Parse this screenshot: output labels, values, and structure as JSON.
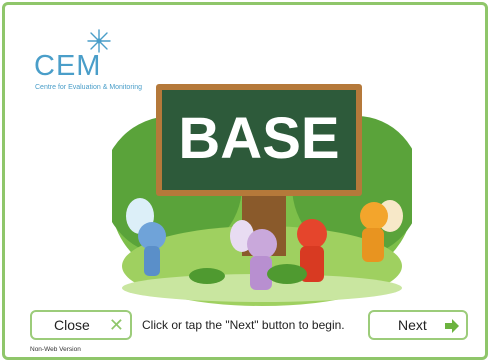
{
  "logo": {
    "text": "CEM",
    "subtitle": "Centre for Evaluation & Monitoring",
    "color": "#4a9ec9"
  },
  "hero": {
    "board_text": "BASE"
  },
  "buttons": {
    "close_label": "Close",
    "close_icon": "x-icon",
    "next_label": "Next",
    "next_icon": "arrow-right-icon"
  },
  "instruction": "Click or tap the \"Next\" button to begin.",
  "version": "Non-Web Version",
  "colors": {
    "frame_border": "#8fc66a",
    "button_border": "#9ccc7a",
    "board": "#2d5a3a",
    "accent_green": "#6cb33f"
  }
}
